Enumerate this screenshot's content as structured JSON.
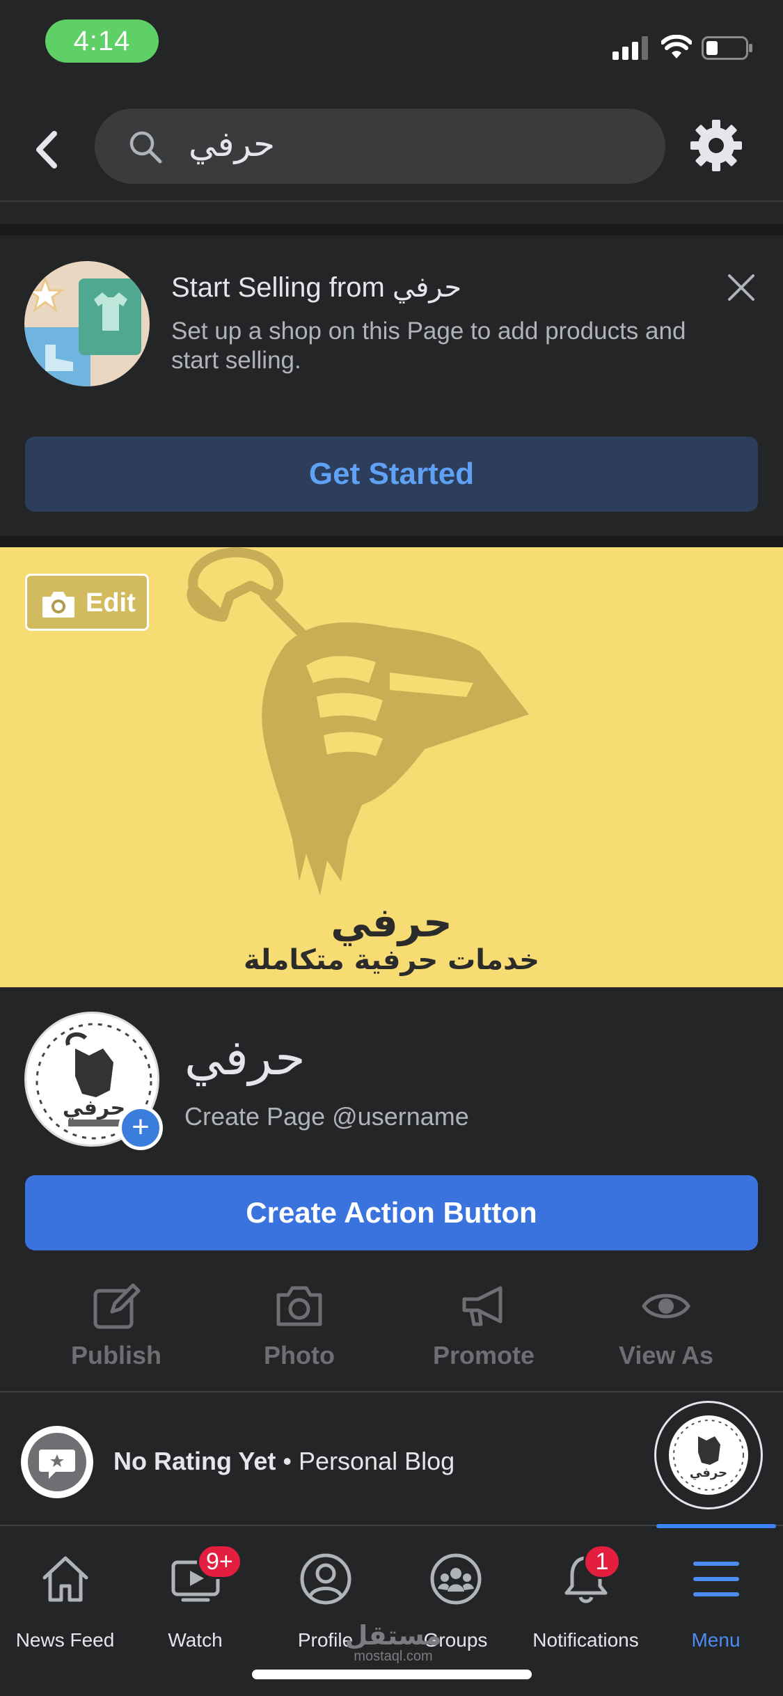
{
  "status_bar": {
    "time": "4:14"
  },
  "search": {
    "query": "حرفي"
  },
  "shop_promo": {
    "title": "Start Selling from حرفي",
    "description": "Set up a shop on this Page to add products and start selling.",
    "cta_label": "Get Started"
  },
  "cover": {
    "edit_label": "Edit",
    "logo_text": "حرفي",
    "tagline": "خدمات حرفية متكاملة"
  },
  "page": {
    "name": "حرفي",
    "username_prompt": "Create Page @username",
    "action_button_label": "Create Action Button"
  },
  "quick_actions": [
    {
      "label": "Publish",
      "icon": "edit-icon"
    },
    {
      "label": "Photo",
      "icon": "camera-icon"
    },
    {
      "label": "Promote",
      "icon": "megaphone-icon"
    },
    {
      "label": "View As",
      "icon": "eye-icon"
    }
  ],
  "rating": {
    "status": "No Rating Yet",
    "separator": "•",
    "category": "Personal Blog"
  },
  "tabs": [
    {
      "label": "News Feed",
      "icon": "home-icon",
      "badge": ""
    },
    {
      "label": "Watch",
      "icon": "video-icon",
      "badge": "9+"
    },
    {
      "label": "Profile",
      "icon": "profile-icon",
      "badge": ""
    },
    {
      "label": "Groups",
      "icon": "groups-icon",
      "badge": ""
    },
    {
      "label": "Notifications",
      "icon": "bell-icon",
      "badge": "1"
    },
    {
      "label": "Menu",
      "icon": "hamburger-icon",
      "badge": "",
      "active": true
    }
  ],
  "watermark": {
    "arabic": "مستقل",
    "latin": "mostaql.com"
  },
  "colors": {
    "background": "#242526",
    "primary_button": "#3a73de",
    "secondary_button": "#2d3e5c",
    "accent": "#4d8df3",
    "badge": "#e41e3f",
    "cover": "#f6dc72",
    "time_pill": "#5fd065"
  }
}
